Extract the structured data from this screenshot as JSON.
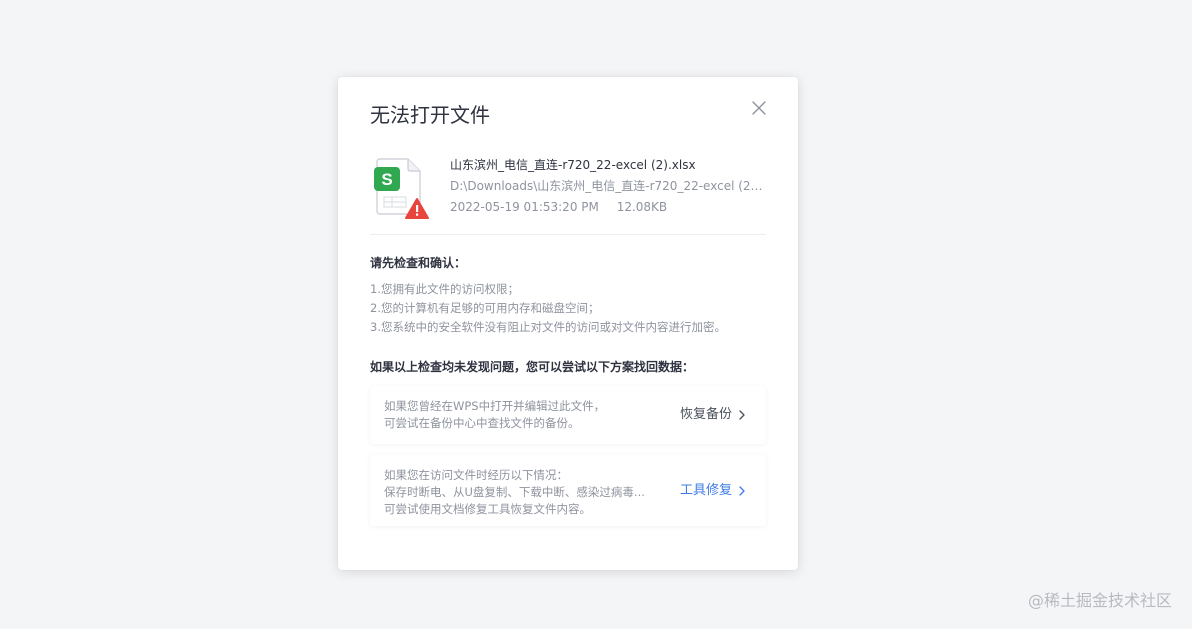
{
  "dialog": {
    "title": "无法打开文件",
    "close_icon": "close-icon"
  },
  "file": {
    "icon": "spreadsheet-error-icon",
    "icon_letter": "S",
    "name": "山东滨州_电信_直连-r720_22-excel (2).xlsx",
    "path": "D:\\Downloads\\山东滨州_电信_直连-r720_22-excel (2)...",
    "datetime": "2022-05-19  01:53:20 PM",
    "size": "12.08KB"
  },
  "check": {
    "heading": "请先检查和确认：",
    "items": [
      "1.您拥有此文件的访问权限；",
      "2.您的计算机有足够的可用内存和磁盘空间；",
      "3.您系统中的安全软件没有阻止对文件的访问或对文件内容进行加密。"
    ]
  },
  "solutions": {
    "heading": "如果以上检查均未发现问题，您可以尝试以下方案找回数据：",
    "backup": {
      "lines": [
        "如果您曾经在WPS中打开并编辑过此文件，",
        "可尝试在备份中心中查找文件的备份。"
      ],
      "action": "恢复备份"
    },
    "repair": {
      "lines": [
        "如果您在访问文件时经历以下情况：",
        "保存时断电、从U盘复制、下载中断、感染过病毒...",
        "可尝试使用文档修复工具恢复文件内容。"
      ],
      "action": "工具修复"
    }
  },
  "colors": {
    "accent": "#3e7be6",
    "file_green": "#2fa84f",
    "warning_red": "#e8453c"
  },
  "watermark": "@稀土掘金技术社区"
}
